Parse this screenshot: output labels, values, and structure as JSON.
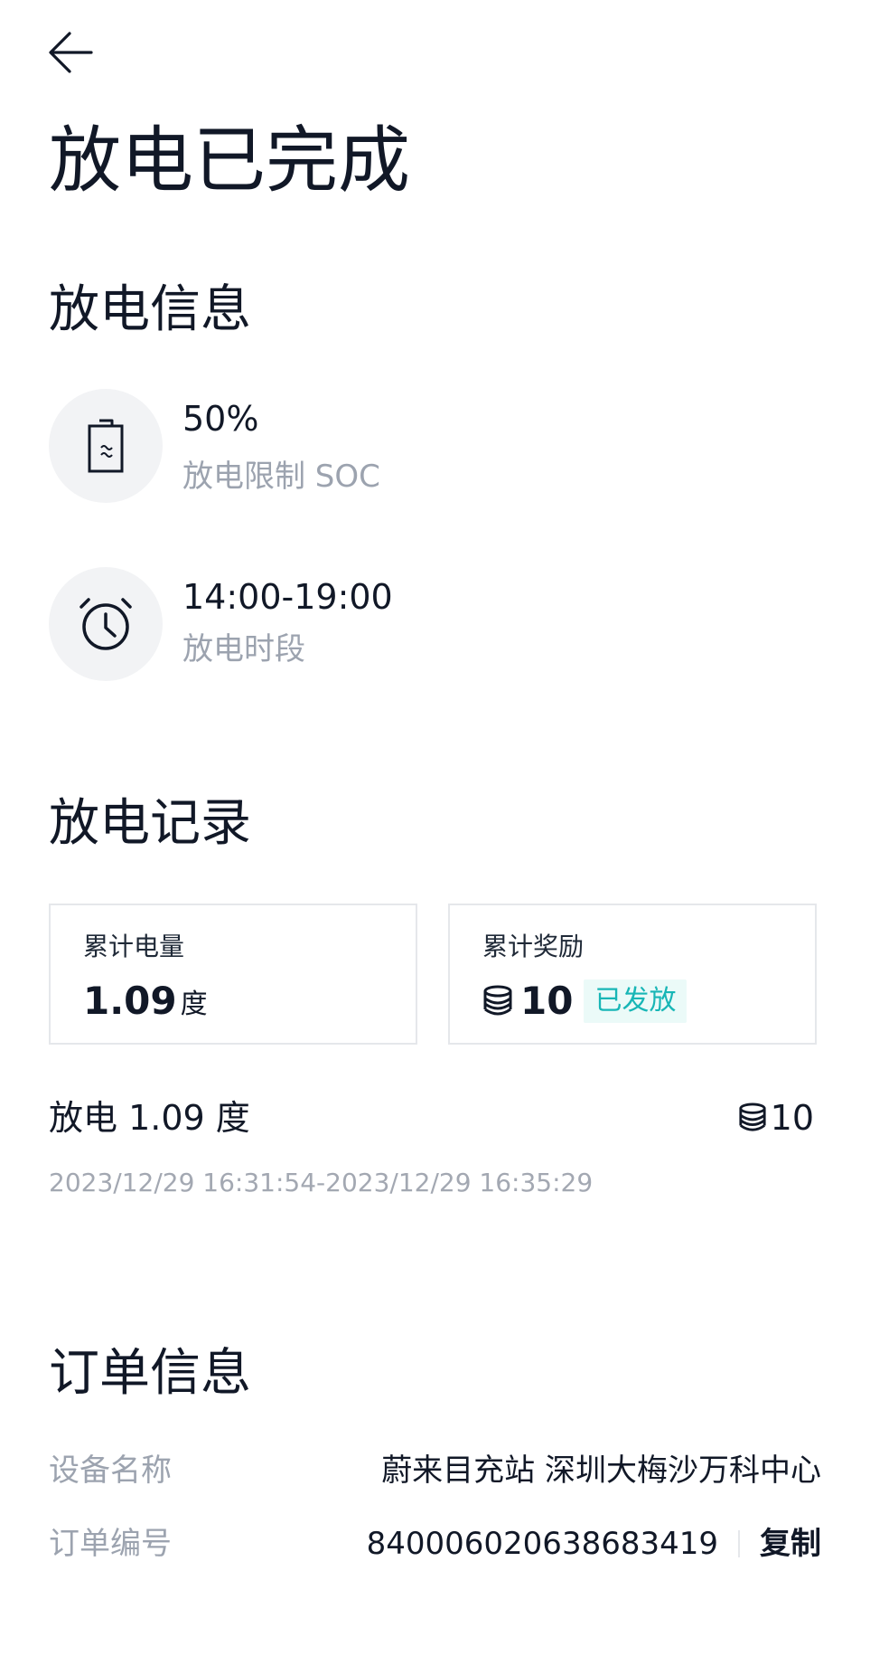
{
  "header": {
    "title": "放电已完成"
  },
  "discharge_info": {
    "section_title": "放电信息",
    "items": [
      {
        "value": "50%",
        "label": "放电限制 SOC",
        "icon": "battery-icon"
      },
      {
        "value": "14:00-19:00",
        "label": "放电时段",
        "icon": "alarm-clock-icon"
      }
    ]
  },
  "discharge_record": {
    "section_title": "放电记录",
    "energy_card": {
      "label": "累计电量",
      "value": "1.09",
      "unit": "度"
    },
    "reward_card": {
      "label": "累计奖励",
      "value": "10",
      "status": "已发放",
      "icon": "coin-stack-icon"
    },
    "records": [
      {
        "title": "放电 1.09 度",
        "reward": "10",
        "time": "2023/12/29 16:31:54-2023/12/29 16:35:29"
      }
    ]
  },
  "order_info": {
    "section_title": "订单信息",
    "rows": [
      {
        "label": "设备名称",
        "value": "蔚来目充站 深圳大梅沙万科中心"
      },
      {
        "label": "订单编号",
        "value": "840006020638683419"
      }
    ],
    "copy_label": "复制"
  },
  "colors": {
    "text_primary": "#111827",
    "text_secondary": "#9ca3af",
    "accent_teal": "#18b6b6",
    "badge_bg": "#ebfaf8",
    "icon_bg": "#f2f3f5"
  }
}
